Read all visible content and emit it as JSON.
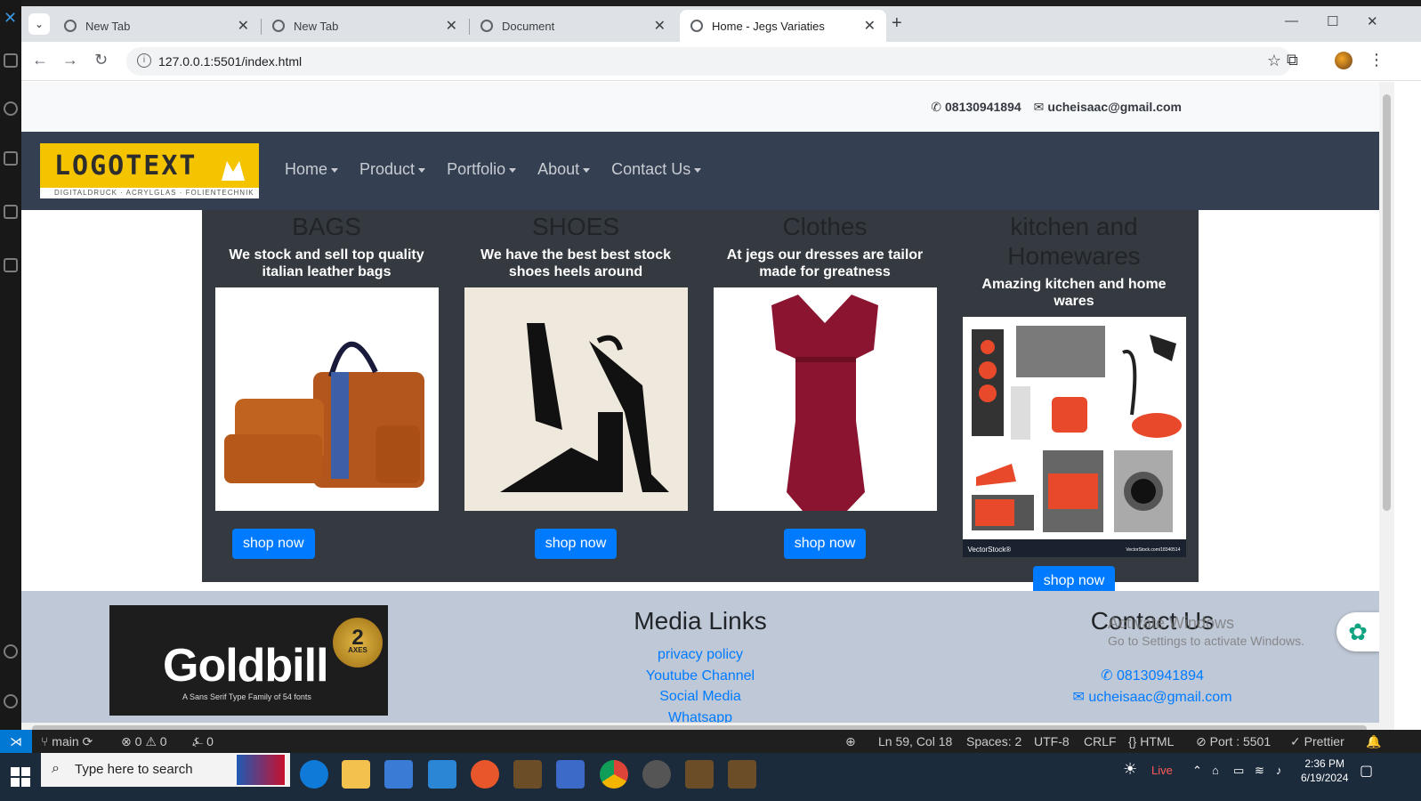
{
  "browser": {
    "tabs": [
      {
        "title": "New Tab",
        "active": false
      },
      {
        "title": "New Tab",
        "active": false
      },
      {
        "title": "Document",
        "active": false
      },
      {
        "title": "Home - Jegs Variaties",
        "active": true
      }
    ],
    "url": "127.0.0.1:5501/index.html"
  },
  "site": {
    "topbar": {
      "phone": "08130941894",
      "email": "ucheisaac@gmail.com"
    },
    "logo": {
      "text": "LOGOTEXT",
      "subtext": "DIGITALDRUCK · ACRYLGLAS · FOLIENTECHNIK"
    },
    "nav": [
      "Home",
      "Product",
      "Portfolio",
      "About",
      "Contact Us"
    ],
    "products": [
      {
        "title": "BAGS",
        "desc": "We stock and sell top quality italian leather bags",
        "button": "shop now",
        "image": "leather-bags-image"
      },
      {
        "title": "SHOES",
        "desc": "We have the best best stock shoes heels around",
        "button": "shop now",
        "image": "heels-image"
      },
      {
        "title": "Clothes",
        "desc": "At jegs our dresses are tailor made for greatness",
        "button": "shop now",
        "image": "red-dress-image"
      },
      {
        "title": "kitchen and Homewares",
        "desc": "Amazing kitchen and home wares",
        "button": "shop now",
        "image": "appliances-image",
        "watermark_left": "VectorStock®",
        "watermark_right": "VectorStock.com/18340514"
      }
    ],
    "footer": {
      "goldbill": {
        "title": "Goldbill",
        "subtitle": "A Sans Serif Type Family of 54 fonts",
        "badge_num": "2",
        "badge_text": "AXES"
      },
      "media_title": "Media Links",
      "media_links": [
        "privacy policy",
        "Youtube Channel",
        "Social Media",
        "Whatsapp"
      ],
      "contact_title": "Contact Us",
      "contact_phone": "08130941894",
      "contact_email": "ucheisaac@gmail.com"
    }
  },
  "overlay": {
    "activate_title": "Activate Windows",
    "activate_sub": "Go to Settings to activate Windows."
  },
  "statusbar": {
    "branch": "main",
    "errors": "0",
    "warnings": "0",
    "ports": "0",
    "position": "Ln 59, Col 18",
    "spaces": "Spaces: 2",
    "encoding": "UTF-8",
    "eol": "CRLF",
    "language": "HTML",
    "port": "Port : 5501",
    "formatter": "Prettier"
  },
  "taskbar": {
    "search_placeholder": "Type here to search",
    "live": "Live",
    "time": "2:36 PM",
    "date": "6/19/2024"
  },
  "colors": {
    "navbar": "#343f51",
    "products_bg": "#343a40",
    "button": "#007bff",
    "footer": "#bfc8d6",
    "logo_yellow": "#f5c400"
  }
}
